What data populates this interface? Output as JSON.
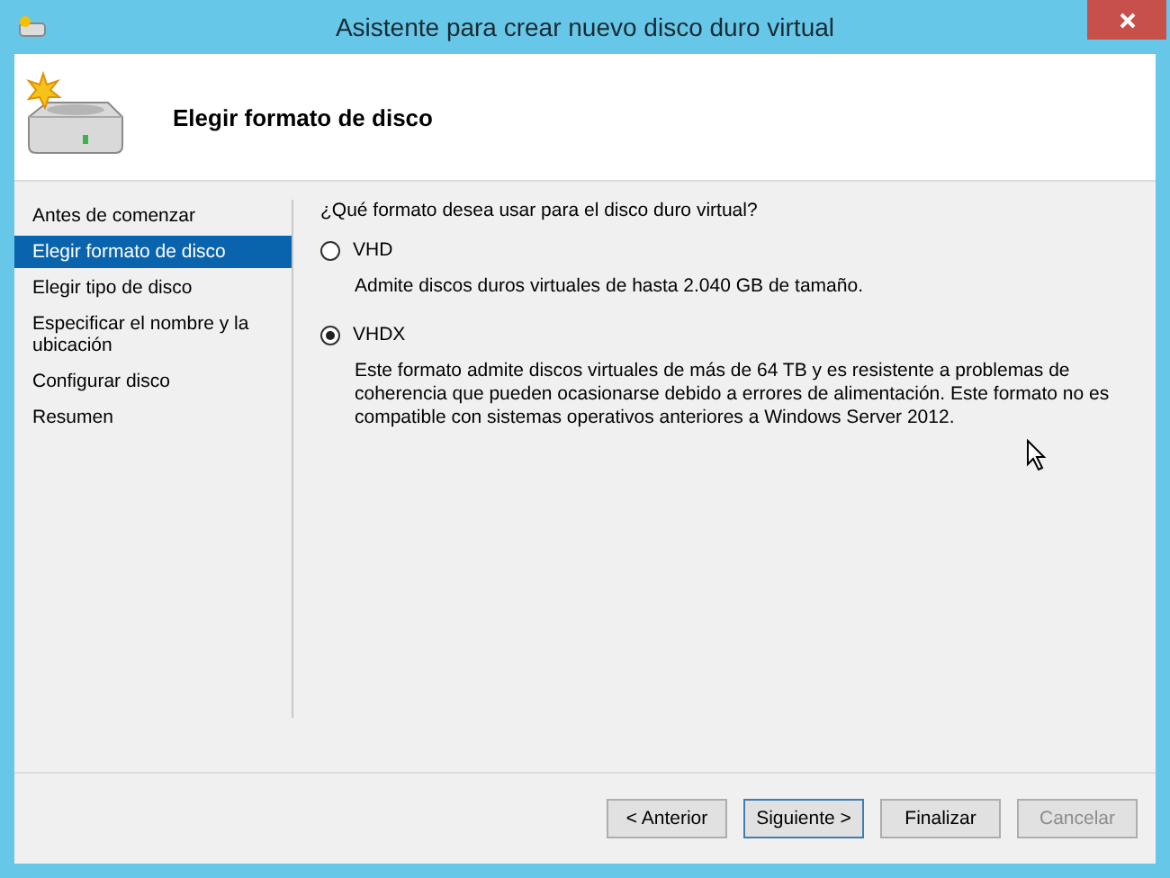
{
  "window": {
    "title": "Asistente para crear nuevo disco duro virtual"
  },
  "header": {
    "title": "Elegir formato de disco"
  },
  "sidebar": {
    "items": [
      {
        "label": "Antes de comenzar",
        "selected": false
      },
      {
        "label": "Elegir formato de disco",
        "selected": true
      },
      {
        "label": "Elegir tipo de disco",
        "selected": false
      },
      {
        "label": "Especificar el nombre y la ubicación",
        "selected": false
      },
      {
        "label": "Configurar disco",
        "selected": false
      },
      {
        "label": "Resumen",
        "selected": false
      }
    ]
  },
  "question": "¿Qué formato desea usar para el disco duro virtual?",
  "options": [
    {
      "label": "VHD",
      "selected": false,
      "description": "Admite discos duros virtuales de hasta 2.040 GB de tamaño."
    },
    {
      "label": "VHDX",
      "selected": true,
      "description": "Este formato admite discos virtuales de más de 64 TB y es resistente a problemas de coherencia que pueden ocasionarse debido a errores de alimentación. Este formato no es compatible con sistemas operativos anteriores a Windows Server 2012."
    }
  ],
  "buttons": [
    {
      "label": "< Anterior",
      "disabled": false,
      "focused": false
    },
    {
      "label": "Siguiente >",
      "disabled": false,
      "focused": true
    },
    {
      "label": "Finalizar",
      "disabled": false,
      "focused": false
    },
    {
      "label": "Cancelar",
      "disabled": true,
      "focused": false
    }
  ]
}
